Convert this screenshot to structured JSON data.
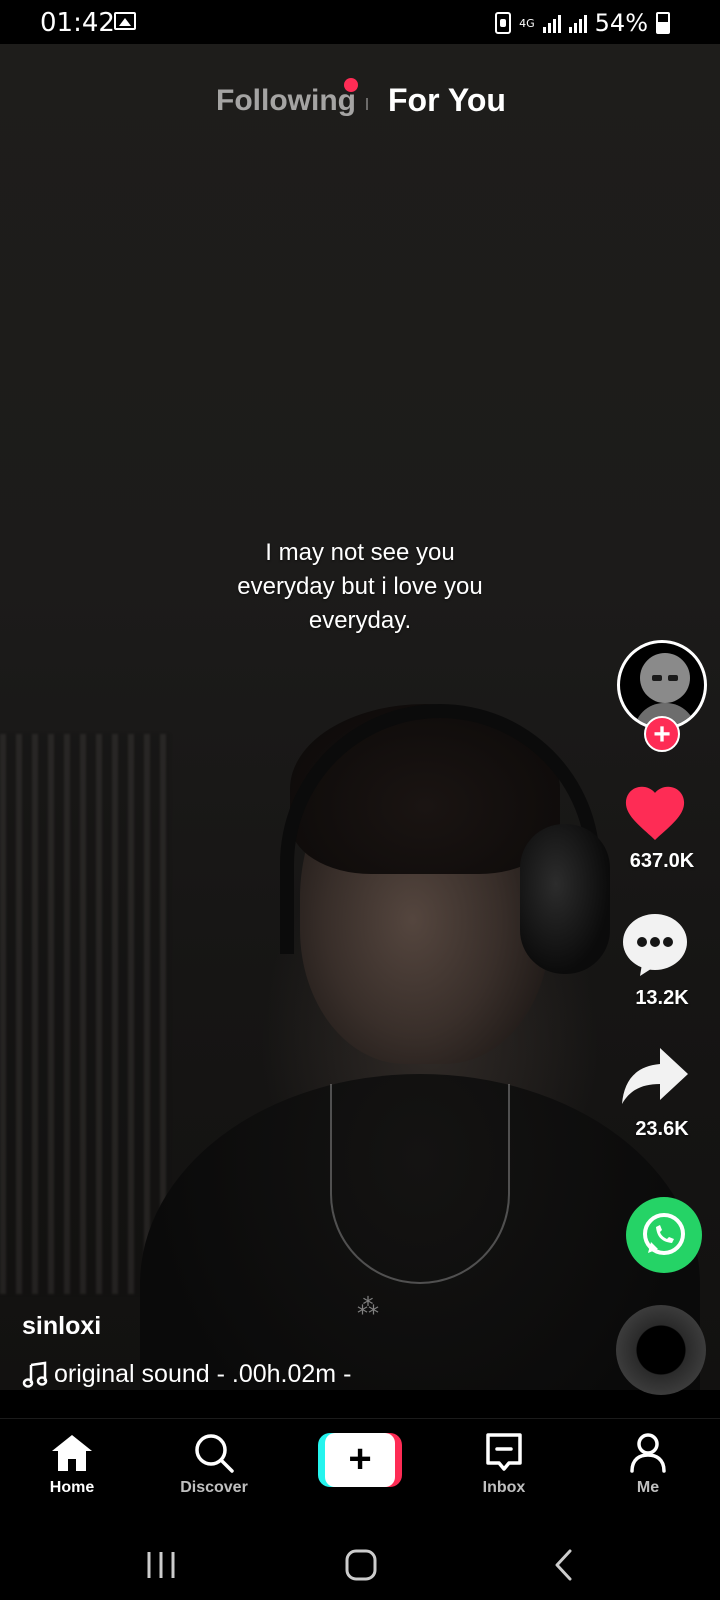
{
  "status_bar": {
    "time": "01:42",
    "network": "4G",
    "battery": "54%",
    "icons": [
      "image-icon",
      "battery-saver-icon",
      "signal-icon",
      "signal-icon",
      "battery-icon"
    ]
  },
  "top_tabs": {
    "following": "Following",
    "for_you": "For You",
    "notification_color": "#fe2c55"
  },
  "video": {
    "caption_line1": "I may not see you",
    "caption_line2": "everyday but i love you",
    "caption_line3": "everyday."
  },
  "actions": {
    "likes": "637.0K",
    "comments": "13.2K",
    "shares": "23.6K",
    "like_color": "#fe2c55",
    "whatsapp_color": "#25d366"
  },
  "post": {
    "username": "sinloxi",
    "sound": "original sound - .00h.02m -"
  },
  "bottom_nav": {
    "home": "Home",
    "discover": "Discover",
    "inbox": "Inbox",
    "me": "Me",
    "create_symbol": "+"
  }
}
